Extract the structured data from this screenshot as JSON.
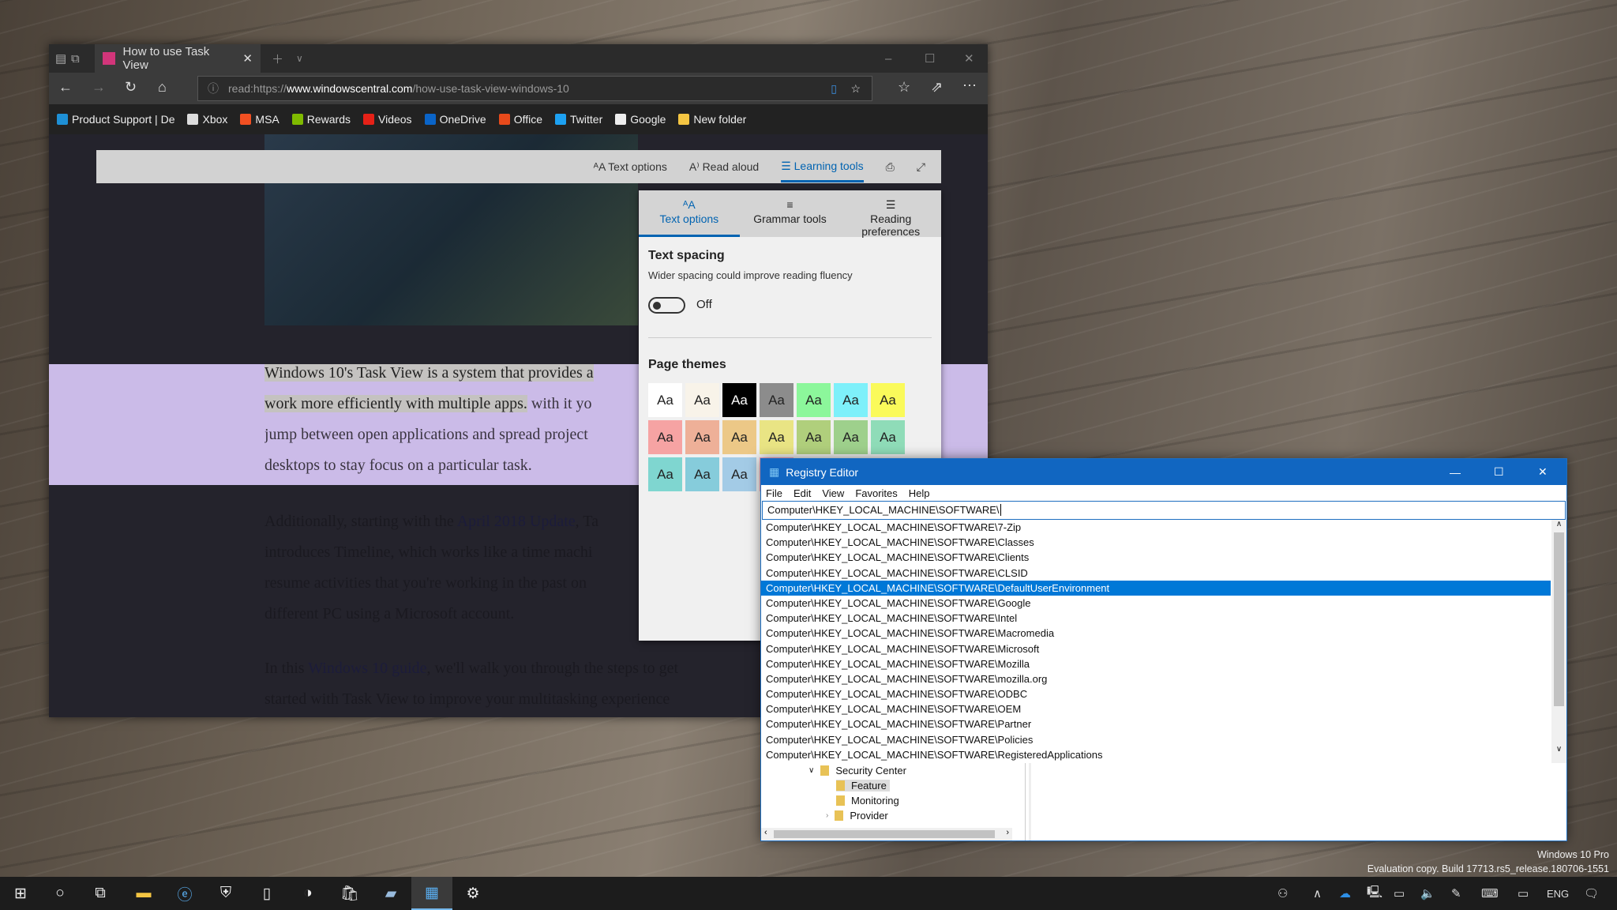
{
  "browser": {
    "tab_title": "How to use Task View",
    "url_prefix": "read:https://",
    "url_domain": "www.windowscentral.com",
    "url_path": "/how-use-task-view-windows-10",
    "favorites": [
      {
        "label": "Product Support | De",
        "color": "#1e90d6"
      },
      {
        "label": "Xbox",
        "color": "#ddd"
      },
      {
        "label": "MSA",
        "color": "#f25022"
      },
      {
        "label": "Rewards",
        "color": "#7fba00"
      },
      {
        "label": "Videos",
        "color": "#e62117"
      },
      {
        "label": "OneDrive",
        "color": "#0a64c8"
      },
      {
        "label": "Office",
        "color": "#e84a1b"
      },
      {
        "label": "Twitter",
        "color": "#1da1f2"
      },
      {
        "label": "Google",
        "color": "#eeeeee"
      },
      {
        "label": "New folder",
        "color": "#f4c542"
      }
    ]
  },
  "reader_toolbar": {
    "text_options": "Text options",
    "read_aloud": "Read aloud",
    "learning_tools": "Learning tools"
  },
  "article": {
    "p1": {
      "hl1": "Windows 10's Task View is a system that provides a",
      "hl2": "work more efficiently with multiple apps.",
      "rest2": " with it yo",
      "line3": "jump between open applications and spread project",
      "line4": "desktops to stay focus on a particular task."
    },
    "p2": {
      "a": "Additionally, starting with the ",
      "link": "April 2018 Update",
      "b": ", Ta",
      "line2": "introduces Timeline, which works like a time machi",
      "line3": "resume activities that you're working in the past on",
      "line4": "different PC using a Microsoft account."
    },
    "p3": {
      "a": "In this ",
      "link": "Windows 10 guide",
      "b": ", we'll walk you through the steps to get",
      "line2": "started with Task View to improve your multitasking experience"
    }
  },
  "learning_panel": {
    "tabs": [
      "Text options",
      "Grammar tools",
      "Reading preferences"
    ],
    "active_tab": "Text options",
    "text_spacing": {
      "title": "Text spacing",
      "desc": "Wider spacing could improve reading fluency",
      "state": "Off"
    },
    "page_themes": {
      "title": "Page themes",
      "swatch_label": "Aa",
      "colors": [
        "#ffffff",
        "#f8f3e9",
        "#000000",
        "#8c8c8c",
        "#8cf79b",
        "#7ef0fa",
        "#fafa5a",
        "#f6a3a3",
        "#eeb098",
        "#ecc887",
        "#e9e484",
        "#b0cf7c",
        "#9ed08c",
        "#8fdcb8",
        "#7fd6d0",
        "#86ccdb",
        "#a3cbe6",
        "#f6a4be"
      ]
    }
  },
  "registry": {
    "title": "Registry Editor",
    "menu": [
      "File",
      "Edit",
      "View",
      "Favorites",
      "Help"
    ],
    "address": "Computer\\HKEY_LOCAL_MACHINE\\SOFTWARE\\",
    "suggestions": [
      "Computer\\HKEY_LOCAL_MACHINE\\SOFTWARE\\7-Zip",
      "Computer\\HKEY_LOCAL_MACHINE\\SOFTWARE\\Classes",
      "Computer\\HKEY_LOCAL_MACHINE\\SOFTWARE\\Clients",
      "Computer\\HKEY_LOCAL_MACHINE\\SOFTWARE\\CLSID",
      "Computer\\HKEY_LOCAL_MACHINE\\SOFTWARE\\DefaultUserEnvironment",
      "Computer\\HKEY_LOCAL_MACHINE\\SOFTWARE\\Google",
      "Computer\\HKEY_LOCAL_MACHINE\\SOFTWARE\\Intel",
      "Computer\\HKEY_LOCAL_MACHINE\\SOFTWARE\\Macromedia",
      "Computer\\HKEY_LOCAL_MACHINE\\SOFTWARE\\Microsoft",
      "Computer\\HKEY_LOCAL_MACHINE\\SOFTWARE\\Mozilla",
      "Computer\\HKEY_LOCAL_MACHINE\\SOFTWARE\\mozilla.org",
      "Computer\\HKEY_LOCAL_MACHINE\\SOFTWARE\\ODBC",
      "Computer\\HKEY_LOCAL_MACHINE\\SOFTWARE\\OEM",
      "Computer\\HKEY_LOCAL_MACHINE\\SOFTWARE\\Partner",
      "Computer\\HKEY_LOCAL_MACHINE\\SOFTWARE\\Policies",
      "Computer\\HKEY_LOCAL_MACHINE\\SOFTWARE\\RegisteredApplications"
    ],
    "selected_index": 4,
    "tree": [
      "Security Center",
      "Feature",
      "Monitoring",
      "Provider"
    ]
  },
  "watermark": {
    "line1": "Windows 10 Pro",
    "line2": "Evaluation copy. Build 17713.rs5_release.180706-1551"
  },
  "taskbar": {
    "language": "ENG"
  }
}
